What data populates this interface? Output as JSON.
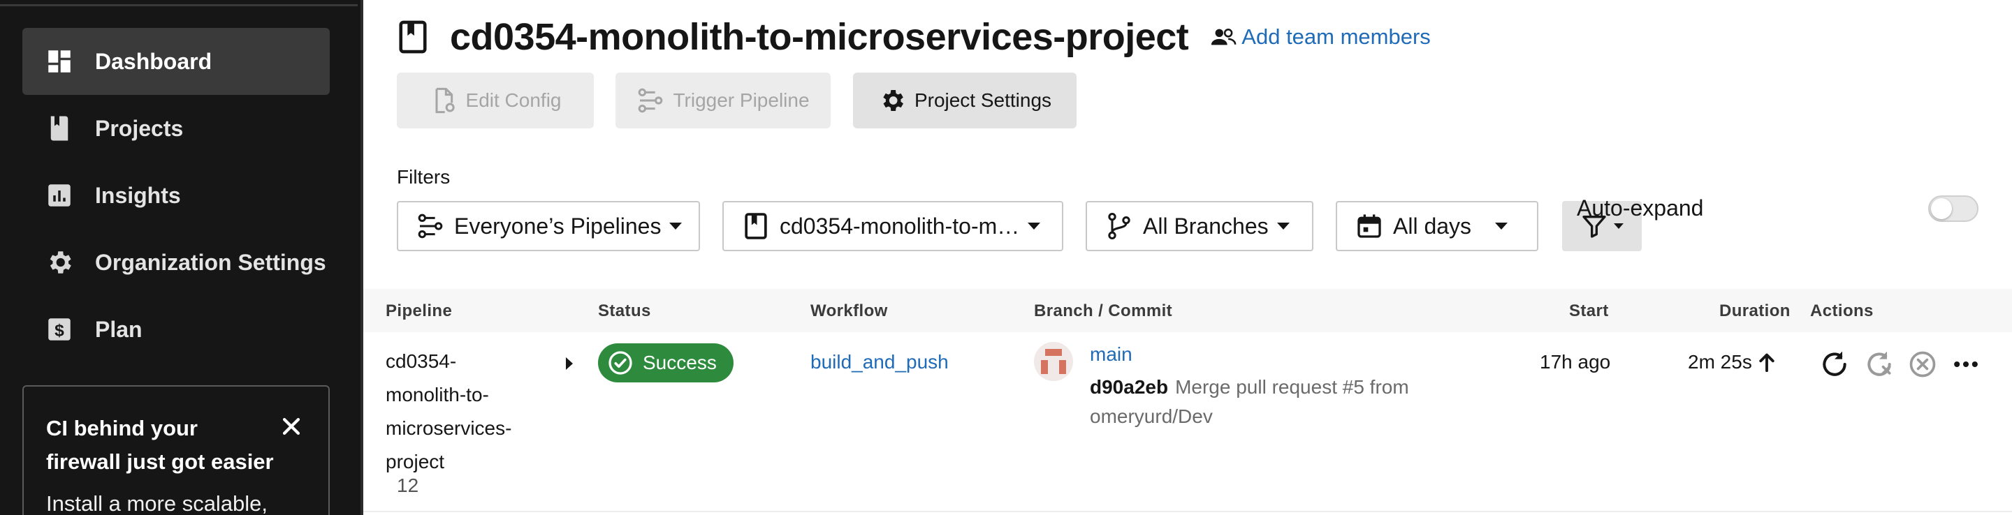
{
  "sidebar": {
    "items": [
      {
        "label": "Dashboard",
        "icon": "dashboard-icon",
        "active": true
      },
      {
        "label": "Projects",
        "icon": "book-icon"
      },
      {
        "label": "Insights",
        "icon": "chart-icon"
      },
      {
        "label": "Organization Settings",
        "icon": "gear-icon"
      },
      {
        "label": "Plan",
        "icon": "dollar-icon"
      }
    ],
    "promo": {
      "title": "CI behind your firewall just got easier",
      "body": "Install a more scalable,"
    }
  },
  "header": {
    "title": "cd0354-monolith-to-microservices-project",
    "add_team": "Add team members"
  },
  "toolbar": {
    "edit_config": "Edit Config",
    "trigger_pipeline": "Trigger Pipeline",
    "project_settings": "Project Settings"
  },
  "filters": {
    "label": "Filters",
    "pipelines": "Everyone’s Pipelines",
    "project": "cd0354-monolith-to-m…",
    "branches": "All Branches",
    "days": "All days",
    "auto_expand": "Auto-expand",
    "auto_expand_on": false
  },
  "table": {
    "headers": {
      "pipeline": "Pipeline",
      "status": "Status",
      "workflow": "Workflow",
      "branch_commit": "Branch / Commit",
      "start": "Start",
      "duration": "Duration",
      "actions": "Actions"
    },
    "rows": [
      {
        "pipeline": "cd0354-monolith-to-microservices-project",
        "pipeline_lines": [
          "cd0354-",
          "monolith-to-",
          "microservices-",
          "project"
        ],
        "number": "12",
        "status": "Success",
        "workflow": "build_and_push",
        "branch": "main",
        "commit_hash": "d90a2eb",
        "commit_message": "Merge pull request #5 from omeryurd/Dev",
        "start": "17h ago",
        "duration": "2m 25s"
      }
    ]
  },
  "colors": {
    "sidebar_bg": "#161616",
    "link": "#1f6bb8",
    "success": "#2e8b3e"
  }
}
